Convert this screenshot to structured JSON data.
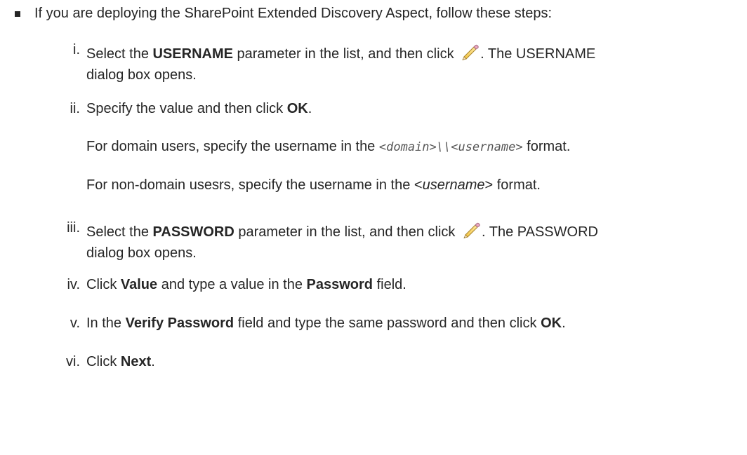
{
  "intro": "If you are deploying the SharePoint Extended Discovery Aspect, follow these steps:",
  "steps": [
    {
      "num": "i.",
      "pre": "Select the ",
      "bold1": "USERNAME",
      "mid": " parameter in the list, and then click ",
      "post": ". The USERNAME",
      "line2": "dialog box opens."
    },
    {
      "num": "ii.",
      "pre": "Specify the value and then click ",
      "bold1": "OK",
      "post": "."
    },
    {
      "num": "iii.",
      "pre": "Select the ",
      "bold1": "PASSWORD",
      "mid": " parameter in the list, and then click ",
      "post": ". The PASSWORD",
      "line2": "dialog box opens."
    },
    {
      "num": "iv.",
      "pre": "Click ",
      "bold1": "Value",
      "mid": " and type a value in the ",
      "bold2": "Password",
      "post": " field."
    },
    {
      "num": "v.",
      "pre": "In the ",
      "bold1": "Verify Password",
      "mid": " field and type the same password and then click ",
      "bold2": "OK",
      "post": "."
    },
    {
      "num": "vi.",
      "pre": "Click ",
      "bold1": "Next",
      "post": "."
    }
  ],
  "domain_note": {
    "pre": "For domain users, specify the username in the ",
    "code": "<domain>\\\\<username>",
    "post": " format."
  },
  "nondomain_note": {
    "pre": "For non-domain usesrs, specify the username in the <",
    "italic": "username",
    "post": "> format."
  },
  "icons": {
    "edit": "pencil-icon"
  }
}
